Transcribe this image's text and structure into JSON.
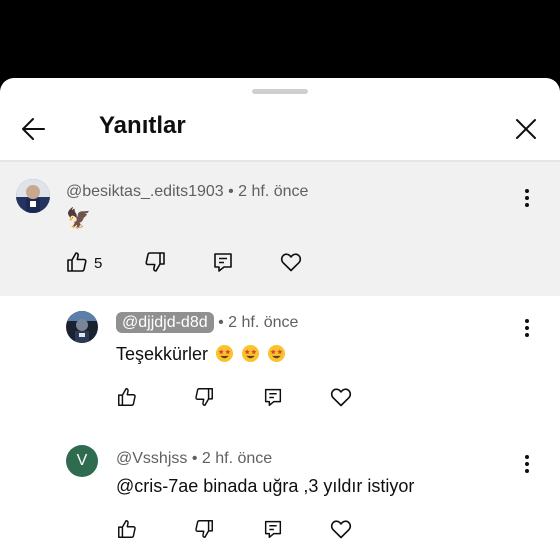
{
  "header": {
    "title": "Yanıtlar"
  },
  "icons": {
    "back": "back-arrow-icon",
    "close": "close-icon",
    "more": "more-vert-icon",
    "like": "thumb-up-icon",
    "dislike": "thumb-down-icon",
    "reply": "reply-icon",
    "heart": "heart-icon"
  },
  "parent_comment": {
    "author": "@besiktas_.edits1903",
    "time": "2 hf. önce",
    "text": "🦅",
    "likes": "5"
  },
  "replies": [
    {
      "author": "@djjdjd-d8d",
      "time": "2 hf. önce",
      "text": "Teşekkürler",
      "emoji_count": 3,
      "highlighted": true
    },
    {
      "author": "@Vsshjss",
      "time": "2 hf. önce",
      "text": "@cris-7ae binada uğra ,3 yıldır istiyor",
      "avatar_letter": "V",
      "avatar_color": "#2e6b4f"
    }
  ],
  "colors": {
    "background_dark": "#000000",
    "parent_bg": "#f1f1f1",
    "meta_text": "#606060",
    "chip_bg": "#909090"
  }
}
